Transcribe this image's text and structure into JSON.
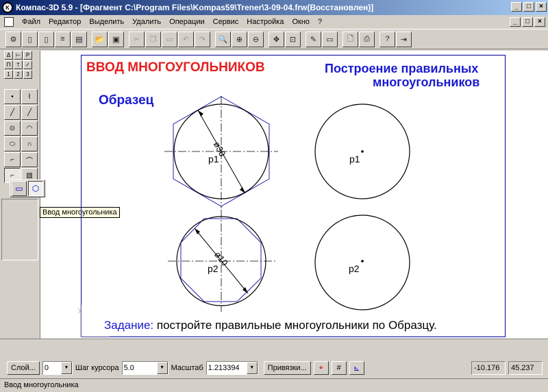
{
  "window": {
    "title": "Компас-3D 5.9 - [Фрагмент C:\\Program Files\\Kompas59\\Trener\\3-09-04.frw(Восстановлен)]",
    "minimize": "_",
    "maximize": "□",
    "close": "×"
  },
  "menu": {
    "items": [
      "Файл",
      "Редактор",
      "Выделить",
      "Удалить",
      "Операции",
      "Сервис",
      "Настройка",
      "Окно",
      "?"
    ]
  },
  "left_panel": {
    "tabs": [
      "Δ",
      "⊢",
      "P",
      "П",
      "†",
      "✓",
      "1",
      "2",
      "3"
    ]
  },
  "tooltip": "Ввод многоугольника",
  "drawing": {
    "title_left": "ВВОД МНОГОУГОЛЬНИКОВ",
    "title_right_1": "Построение правильных",
    "title_right_2": "многоугольников",
    "sample_label": "Образец",
    "point_labels": [
      "p1",
      "p2",
      "p1",
      "p2"
    ],
    "dim_1": "ø30",
    "dim_2": "ø10",
    "task_prefix": "Задание:",
    "task_text": " постройте правильные многоугольники по Образцу.",
    "colors": {
      "title_red": "#e52020",
      "blue": "#1a1ad0",
      "frame": "#00009a",
      "polygon": "#2020b0"
    }
  },
  "statusbar": {
    "layer_button": "Слой...",
    "layer_value": "0",
    "step_label": "Шаг курсора",
    "step_value": "5.0",
    "scale_label": "Масштаб",
    "scale_value": "1.213394",
    "snaps_button": "Привязки...",
    "coord_x": "-10.176",
    "coord_y": "45.237"
  },
  "hint": "Ввод многоугольника"
}
